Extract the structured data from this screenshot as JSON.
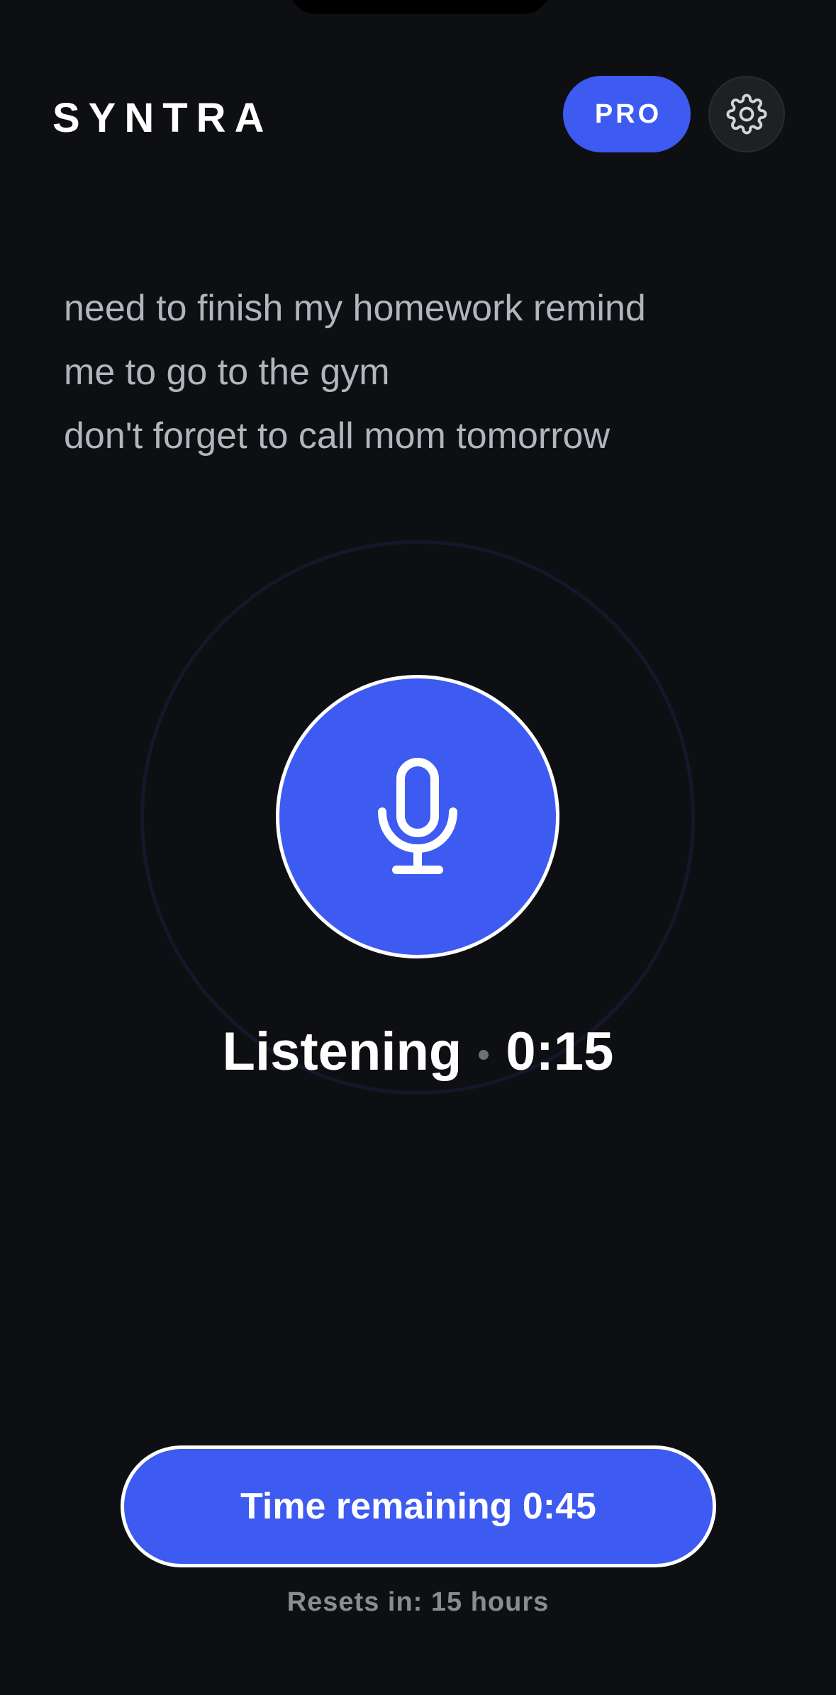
{
  "app": {
    "brand": "SYNTRA"
  },
  "header": {
    "pro_label": "PRO",
    "settings_icon": "gear-icon"
  },
  "transcript": {
    "lines": [
      "need to finish my homework remind",
      "me to go to the gym",
      "don't forget to call mom tomorrow"
    ]
  },
  "recorder": {
    "mic_icon": "microphone-icon",
    "status_label": "Listening",
    "elapsed": "0:15"
  },
  "footer": {
    "time_remaining_label": "Time remaining 0:45",
    "resets_label": "Resets in: 15 hours"
  },
  "colors": {
    "background": "#0e0f12",
    "accent": "#3d5af1",
    "text_muted": "#b3b5bd",
    "settings_bg": "#1f2024"
  }
}
